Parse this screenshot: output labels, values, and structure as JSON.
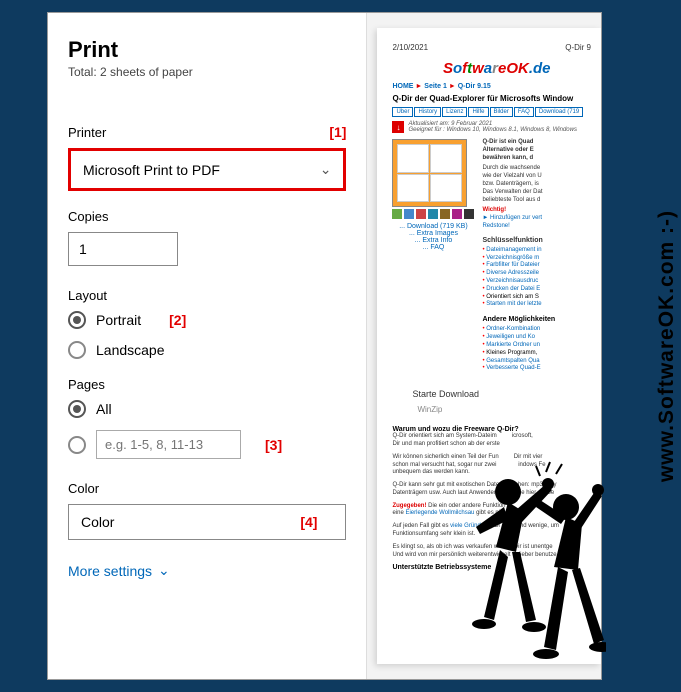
{
  "print": {
    "title": "Print",
    "subtitle": "Total: 2 sheets of paper",
    "help": "?",
    "printer_label": "Printer",
    "printer_value": "Microsoft Print to PDF",
    "copies_label": "Copies",
    "copies_value": "1",
    "layout_label": "Layout",
    "layout_portrait": "Portrait",
    "layout_landscape": "Landscape",
    "pages_label": "Pages",
    "pages_all": "All",
    "pages_placeholder": "e.g. 1-5, 8, 11-13",
    "color_label": "Color",
    "color_value": "Color",
    "more_settings": "More settings"
  },
  "annotations": {
    "a1": "[1]",
    "a2": "[2]",
    "a3": "[3]",
    "a4": "[4]"
  },
  "preview": {
    "date": "2/10/2021",
    "corner": "Q-Dir 9",
    "breadcrumb_home": "HOME",
    "breadcrumb_seite": "Seite 1",
    "breadcrumb_qdir": "Q-Dir 9.15",
    "title": "Q-Dir der Quad-Explorer für Microsofts Window",
    "tabs": [
      "Über",
      "History",
      "Lizenz",
      "Hilfe",
      "Bilder",
      "FAQ",
      "Download (719"
    ],
    "updated_label": "Aktualisiert am: 9 Februar 2021",
    "updated_os": "Geeignet für : Windows 10, Windows 8.1, Windows 8, Windows",
    "desc_title": "Q-Dir ist ein Quad",
    "desc_sub1": "Alternative oder E",
    "desc_sub2": "bewähren kann, d",
    "desc_p1": "Durch die wachsende",
    "desc_p2": "wie der Vielzahl von U",
    "desc_p3": "bzw. Datenträgern, is",
    "desc_p4": "Das Verwalten der Dat",
    "desc_p5": "beliebteste Tool aus d",
    "wichtig": "Wichtig!",
    "hinz": "► Hinzufügen zur vert",
    "redstone": "Redstone!",
    "dl1": "... Download (719 KB)",
    "dl2": "... Extra Images",
    "dl3": "... Extra Info",
    "dl4": "... FAQ",
    "feat_title": "Schlüsselfunktion",
    "feat": [
      "Dateimanagement in",
      "Verzeichnisgröße m",
      "Farbfilter für Dateier",
      "Diverse Adresszeile",
      "Verzeichnisausdruc",
      "Drucken der Datei E",
      "Orientiert sich am S",
      "Starten mit der letzte"
    ],
    "moegl_title": "Andere Möglichkeiten",
    "moegl": [
      "Ordner-Kombination",
      "Jeweiligen und Ko",
      "Markierte Ordner un",
      "Kleines Programm,",
      "Gesamtspalten Qua",
      "Verbesserte Quad-E"
    ],
    "starte": "Starte Download",
    "winzip": "WinZip",
    "q_title": "Warum und wozu die Freeware Q-Dir?",
    "q_p1a": "Q-Dir orientiert sich am System-Dateim",
    "q_p1b": "Dir und man profitiert schon ab der erste",
    "q_p2a": "Wir können sicherlich einen Teil der Fun",
    "q_p2b": "schon mal versucht hat, sogar nur zwei",
    "q_p2c": "unbequem das werden kann.",
    "q_p3a": "Q-Dir kann sehr gut mit exotischen Datenträ",
    "q_p3b": "Datenträgern usw. Auch laut Anwenderauss",
    "zugegeben": "Zugegeben!",
    "q_p4": "Die ein oder andere Funktion",
    "wms": "Eierlegende Wollmilchsau",
    "q_p4b": "gibt es nic",
    "q_p5a": "Auf jeden Fall gibt es",
    "viele": "viele Gründe",
    "q_p5b": ", Q-Di",
    "q_p5c": "Funktionsumfang sehr klein ist.",
    "q_p6a": "Es klingt so, als ob ich was verkaufen will",
    "q_p6b": "Und wird von mir persönlich weiterentwickelt",
    "os_title": "Unterstützte Betriebssysteme",
    "microsoft": "icrosoft,",
    "dirmit": "Dir mit vier",
    "winfe": "indows Fe",
    "mp3": "hen: mp3-Play",
    "siehier": "sie hier die be",
    "qdirist": "Dir ist unentge",
    "lieber": "lieber benutze",
    "undwenige": "und wenige, um"
  },
  "watermark": "www.SoftwareOK.com :-)"
}
